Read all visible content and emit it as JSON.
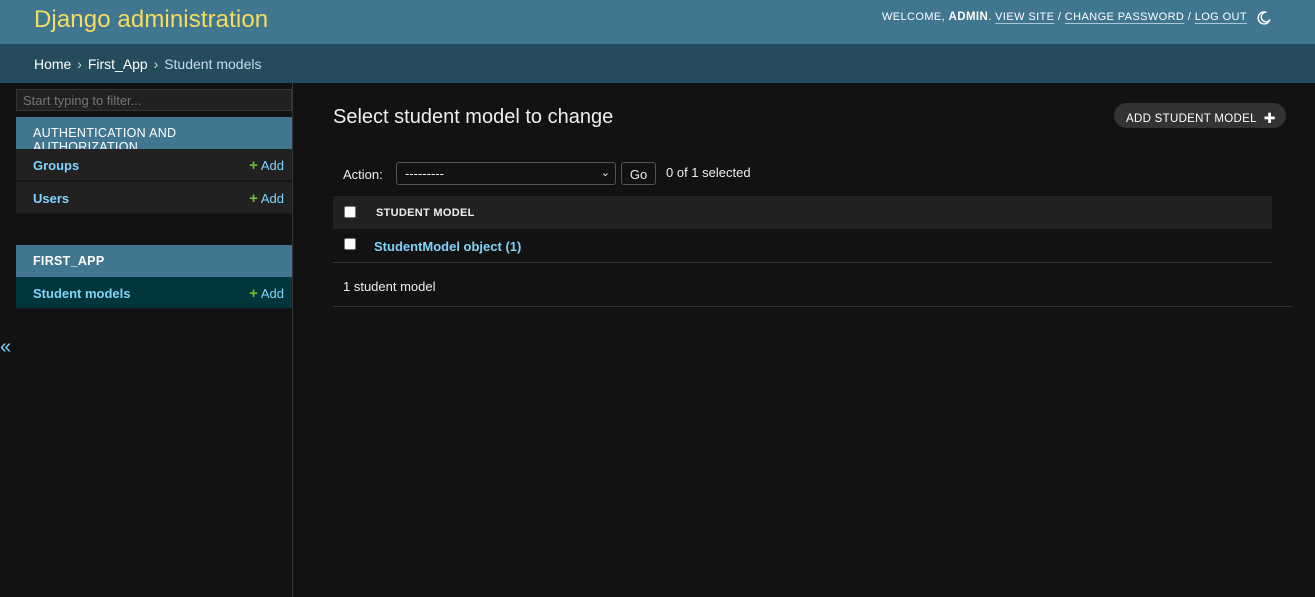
{
  "header": {
    "brand": "Django administration",
    "welcome": "WELCOME,",
    "username": "ADMIN",
    "view_site": "VIEW SITE",
    "change_password": "CHANGE PASSWORD",
    "log_out": "LOG OUT",
    "sep": "/"
  },
  "breadcrumbs": {
    "home": "Home",
    "app": "First_App",
    "current": "Student models",
    "sep": "›"
  },
  "sidebar": {
    "filter_placeholder": "Start typing to filter...",
    "modules": [
      {
        "caption": "AUTHENTICATION AND AUTHORIZATION",
        "models": [
          {
            "label": "Groups",
            "add": "Add"
          },
          {
            "label": "Users",
            "add": "Add"
          }
        ]
      },
      {
        "caption": "FIRST_APP",
        "models": [
          {
            "label": "Student models",
            "add": "Add"
          }
        ]
      }
    ],
    "toggle": "«"
  },
  "content": {
    "title": "Select student model to change",
    "add_button": "ADD STUDENT MODEL",
    "action_label": "Action:",
    "action_selected": "---------",
    "go_label": "Go",
    "counter": "0 of 1 selected",
    "column_header": "STUDENT MODEL",
    "rows": [
      "StudentModel object (1)"
    ],
    "paginator": "1 student model"
  },
  "colors": {
    "header_bg": "#417690",
    "brand": "#f5dd5d",
    "breadcrumbs_bg": "#264b5d",
    "link": "#81d4fa",
    "add_plus": "#70bf2b",
    "selected_row": "#00363b"
  }
}
